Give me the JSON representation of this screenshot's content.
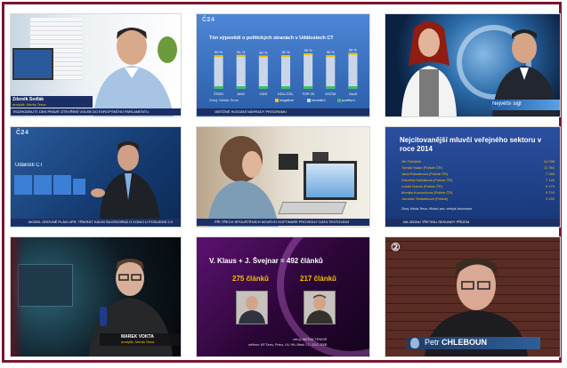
{
  "tile1": {
    "name_tag": "Zdeněk Sedlák",
    "role_tag": "analytik, Media Tenor",
    "ticker": "ROZHODNUTÍ: DEN PRAVÉ OTEVŘENÍ VOLEB DO EVROPSKÉHO PARLAMENTU"
  },
  "tile2": {
    "title": "Tón výpovědí o politických stranách v Událostech ČT",
    "categories": [
      "ČSSD",
      "ANO",
      "ODS",
      "KDU-ČSL",
      "TOP 09",
      "KSČM",
      "Úsvit"
    ],
    "percent_labels": [
      "90 %",
      "91 %",
      "89 %",
      "90 %",
      "95 %",
      "90 %",
      "96 %"
    ],
    "legend": [
      "negativní",
      "neutrální",
      "pozitivní"
    ],
    "source": "Zdroj: Media Tenor",
    "ticker": "OBTÍŽNÉ HLEDÁNÍ NÁHRADY PROGRAMU"
  },
  "tile3": {
    "caption": "Největší sigr"
  },
  "tile4": {
    "chart_label": "Události ČT",
    "ticker": "MODEL ÚROVNĚ PLÁN UPR: TŘIKRÁT KÁLMI SUVZDORNÁ O KONCI U POSLEDNÍ 2.0"
  },
  "tile5": {
    "ticker": "PŘI TŘECH SPOUŠTĚNÍCH NOVÉHO SOFTWARE PROVEDLY DATA TESTOVÁNÍ"
  },
  "tile6": {
    "title": "Nejcitovanější mluvčí veřejného sektoru v roce 2014",
    "rows": [
      {
        "name": "Jiří Ovčáček",
        "value": "14 098"
      },
      {
        "name": "Tomáš Hulan (Policie ČR)",
        "value": "11 764"
      },
      {
        "name": "Jana Rösslerová (Policie ČR)",
        "value": "7 949"
      },
      {
        "name": "Gabriela Holčáková (Policie ČR)",
        "value": "7 143"
      },
      {
        "name": "Lukáš Hurník (Policie ČR)",
        "value": "6 173"
      },
      {
        "name": "Monika Kocourková (Policie ČR)",
        "value": "5 793"
      },
      {
        "name": "Jaroslav Sedláčková (Policie)",
        "value": "5 152"
      }
    ],
    "source": "Zdroj: Media Tenor, Hlídací pes, veřejně zkoumaná",
    "ticker": "NA JEDNU TŘETINU SEKUNDY PŘÍJEM"
  },
  "tile7": {
    "name_tag": "MAREK VOKTA",
    "role_tag": "analytik, Media Tenor"
  },
  "tile8": {
    "headline": "V. Klaus + J. Švejnar = 492 článků",
    "left_count": "275 článků",
    "right_count": "217 článků",
    "footer_1": "zdroj: MEDIA TENOR",
    "footer_2": "měřeno: MF Dnes, Právo, LN, HN, Blesk 1.2.–15.2. 2008"
  },
  "tile9": {
    "name_first": "Petr",
    "name_last": "CHLEBOUN"
  },
  "colors": {
    "frame": "#7a1630",
    "ct24_bar": "#1b2f66",
    "chart_blue": "#3c7fd6",
    "highlight_yellow": "#f2c200",
    "purple": "#4e1166"
  }
}
